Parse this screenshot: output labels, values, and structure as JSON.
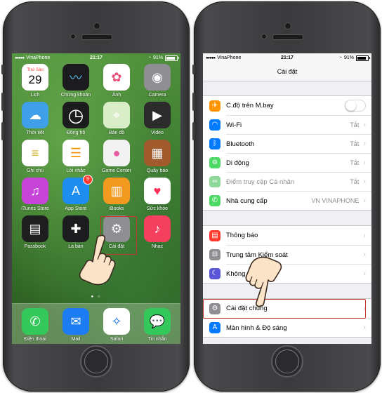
{
  "home_phone": {
    "status": {
      "carrier": "VinaPhone",
      "time": "21:17",
      "battery": "91%"
    },
    "apps": [
      {
        "icon": "calendar-icon",
        "label": "Lịch",
        "day": "Thứ Sáu",
        "date": "29",
        "bg": "#ffffff"
      },
      {
        "icon": "stocks-icon",
        "label": "Chứng khoán",
        "bg": "#1c1c1e"
      },
      {
        "icon": "photos-icon",
        "label": "Ảnh",
        "bg": "#ffffff"
      },
      {
        "icon": "camera-icon",
        "label": "Camera",
        "bg": "#8e8e93"
      },
      {
        "icon": "weather-icon",
        "label": "Thời tiết",
        "bg": "#3f9fe8"
      },
      {
        "icon": "clock-icon",
        "label": "Đồng hồ",
        "bg": "#1c1c1e"
      },
      {
        "icon": "maps-icon",
        "label": "Bản đồ",
        "bg": "#d9eec8"
      },
      {
        "icon": "videos-icon",
        "label": "Video",
        "bg": "#2b2b2b"
      },
      {
        "icon": "notes-icon",
        "label": "Ghi chú",
        "bg": "#ffffff"
      },
      {
        "icon": "reminders-icon",
        "label": "Lời nhắc",
        "bg": "#ffffff"
      },
      {
        "icon": "game-center-icon",
        "label": "Game Center",
        "bg": "#f2f2f2"
      },
      {
        "icon": "newsstand-icon",
        "label": "Quầy báo",
        "bg": "#a05a2c"
      },
      {
        "icon": "itunes-store-icon",
        "label": "iTunes Store",
        "bg": "#c644d8"
      },
      {
        "icon": "app-store-icon",
        "label": "App Store",
        "bg": "#1d8df0",
        "badge": "9"
      },
      {
        "icon": "ibooks-icon",
        "label": "iBooks",
        "bg": "#f29a1f"
      },
      {
        "icon": "health-icon",
        "label": "Sức khỏe",
        "bg": "#ffffff"
      },
      {
        "icon": "passbook-icon",
        "label": "Passbook",
        "bg": "#1e1e1e"
      },
      {
        "icon": "compass-icon",
        "label": "La bàn",
        "bg": "#1c1c1e"
      },
      {
        "icon": "settings-gear-icon",
        "label": "Cài đặt",
        "bg": "#8e8e93"
      },
      {
        "icon": "music-icon",
        "label": "Nhạc",
        "bg": "#f43f5e"
      }
    ],
    "dock": [
      {
        "icon": "phone-icon",
        "label": "Điện thoại",
        "bg": "#34c759"
      },
      {
        "icon": "mail-icon",
        "label": "Mail",
        "bg": "#1d7cf2"
      },
      {
        "icon": "safari-icon",
        "label": "Safari",
        "bg": "#ffffff"
      },
      {
        "icon": "messages-icon",
        "label": "Tin nhắn",
        "bg": "#34c759"
      }
    ]
  },
  "settings_phone": {
    "status": {
      "carrier": "VinaPhone",
      "time": "21:17",
      "battery": "91%"
    },
    "title": "Cài đặt",
    "group1": [
      {
        "icon": "airplane-icon",
        "label": "C.độ trên M.bay",
        "toggle": true,
        "color": "#ff9500"
      },
      {
        "icon": "wifi-icon",
        "label": "Wi-Fi",
        "value": "Tắt",
        "color": "#007aff"
      },
      {
        "icon": "bluetooth-icon",
        "label": "Bluetooth",
        "value": "Tắt",
        "color": "#007aff"
      },
      {
        "icon": "cellular-icon",
        "label": "Di động",
        "value": "Tắt",
        "color": "#4cd964"
      },
      {
        "icon": "hotspot-icon",
        "label": "Điểm truy cập Cá nhân",
        "value": "Tắt",
        "color": "#8fd89a",
        "dim": true
      },
      {
        "icon": "carrier-icon",
        "label": "Nhà cung cấp",
        "value": "VN VINAPHONE",
        "color": "#4cd964"
      }
    ],
    "group2": [
      {
        "icon": "notifications-icon",
        "label": "Thông báo",
        "color": "#ff3b30"
      },
      {
        "icon": "control-center-icon",
        "label": "Trung tâm Kiểm soát",
        "color": "#8e8e93"
      },
      {
        "icon": "do-not-disturb-icon",
        "label": "Không làm phiền",
        "color": "#5856d6"
      }
    ],
    "group3": [
      {
        "icon": "general-gear-icon",
        "label": "Cài đặt chung",
        "color": "#8e8e93"
      },
      {
        "icon": "display-brightness-icon",
        "label": "Màn hình & Độ sáng",
        "color": "#007aff"
      }
    ]
  }
}
